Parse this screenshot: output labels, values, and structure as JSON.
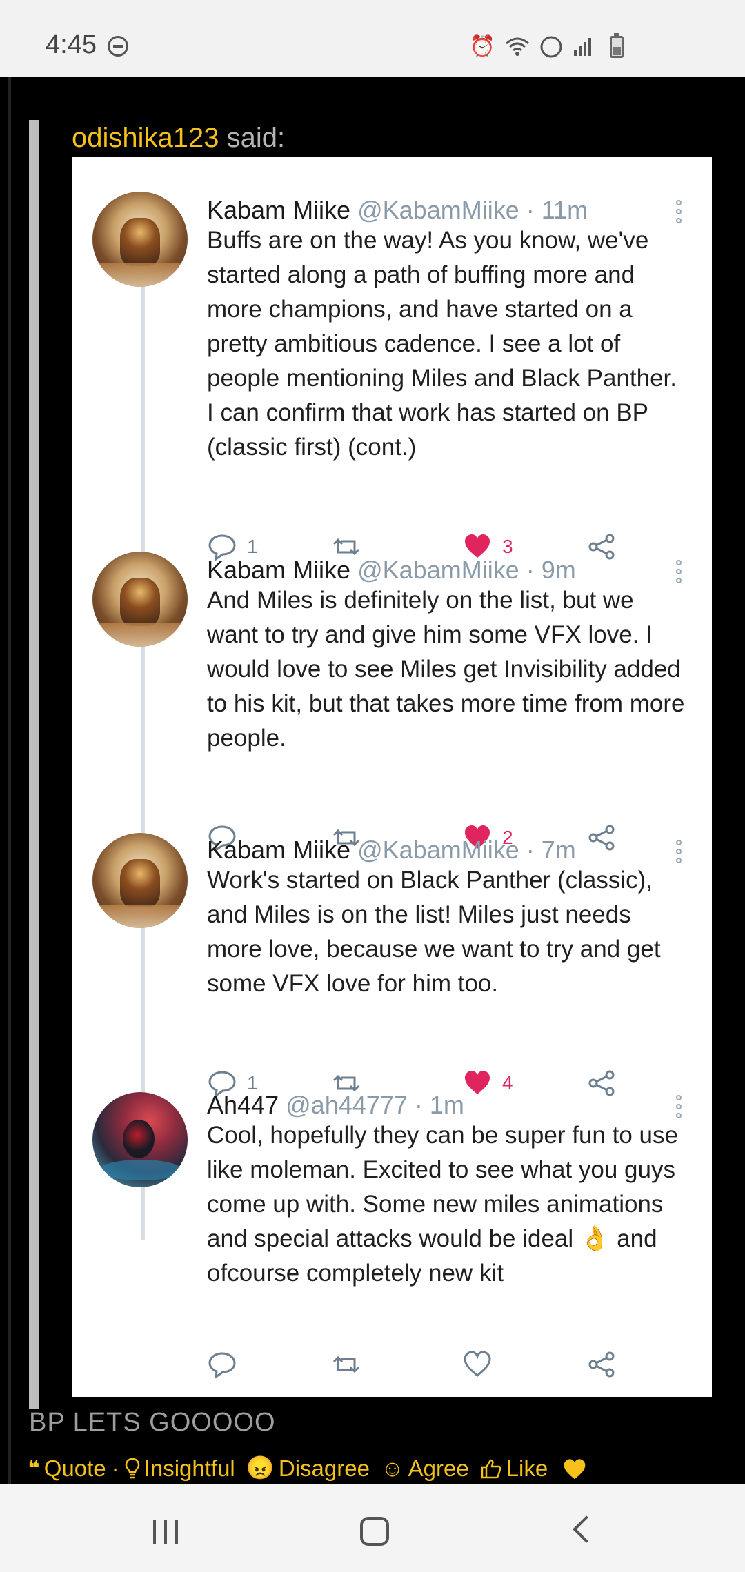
{
  "status_bar": {
    "time": "4:45",
    "icons": [
      "dnd-icon",
      "alarm-icon",
      "wifi-icon",
      "volte-icon",
      "signal-icon",
      "battery-icon"
    ]
  },
  "post": {
    "quote_author": "odishika123",
    "quote_said": " said:",
    "body": "BP LETS GOOOOO",
    "reactions": [
      {
        "label": "Quote",
        "icon": "quote-icon"
      },
      {
        "label": "Insightful",
        "icon": "lightbulb-icon"
      },
      {
        "label": "Disagree",
        "icon": "angry-face-icon"
      },
      {
        "label": "Agree",
        "icon": "smile-face-icon"
      },
      {
        "label": "Like",
        "icon": "thumbs-up-icon"
      },
      {
        "label": "",
        "icon": "heart-icon"
      }
    ],
    "quote_separator": " · "
  },
  "tweets": [
    {
      "name": "Kabam Miike",
      "handle": "@KabamMiike",
      "time": " · 11m",
      "text": "Buffs are on the way! As you know, we've started along a path of buffing more and more champions, and have started on a pretty ambitious cadence. I see a lot of people mentioning Miles and Black Panther. I can confirm that work has started on BP (classic first) (cont.)",
      "replies": "1",
      "likes": "3",
      "liked": true
    },
    {
      "name": "Kabam Miike",
      "handle": "@KabamMiike",
      "time": " · 9m",
      "text": "And Miles is definitely on the list, but we want to try and give him some VFX love. I would love to see Miles get Invisibility added to his kit, but that takes more time from more people.",
      "replies": "",
      "likes": "2",
      "liked": true
    },
    {
      "name": "Kabam Miike",
      "handle": "@KabamMiike",
      "time": " · 7m",
      "text": "Work's started on Black Panther (classic), and Miles is on the list! Miles just needs more love, because we want to try and get some VFX love for him too.",
      "replies": "1",
      "likes": "4",
      "liked": true
    },
    {
      "name": "Ah447",
      "handle": "@ah44777",
      "time": " · 1m",
      "text": "Cool, hopefully they can be super fun to use like moleman. Excited to see what you guys come up with. Some new miles animations and special attacks would be ideal 👌 and ofcourse completely new kit",
      "replies": "",
      "likes": "",
      "liked": false
    }
  ],
  "colors": {
    "accent_yellow": "#f4c21a",
    "like_red": "#e0245e",
    "icon_gray": "#6d7f8e"
  },
  "nav_bar": {
    "buttons": [
      "recent-apps-icon",
      "home-icon",
      "back-icon"
    ]
  }
}
